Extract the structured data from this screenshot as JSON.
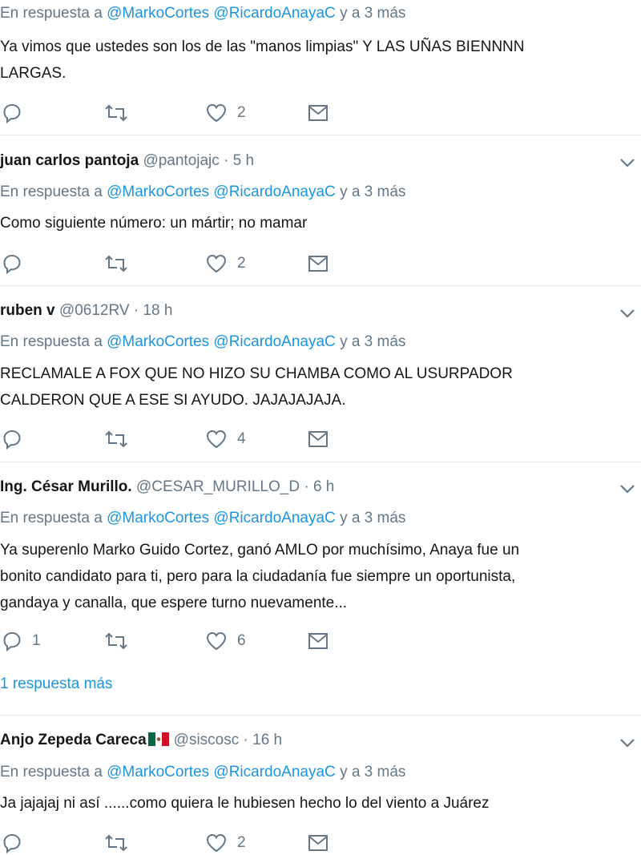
{
  "tweets": [
    {
      "reply_prefix": "En respuesta a",
      "reply_to_1": "@MarkoCortes",
      "reply_to_2": "@RicardoAnayaC",
      "reply_suffix": "y a 3 más",
      "text_1": "Ya vimos que ustedes son los de las \"manos limpias\" Y LAS UÑAS BIENNNN",
      "text_2": "LARGAS.",
      "reply_count": "",
      "like_count": "2"
    },
    {
      "name": "juan carlos pantoja",
      "handle": "@pantojajc",
      "dot": "·",
      "time": "5 h",
      "reply_prefix": "En respuesta a",
      "reply_to_1": "@MarkoCortes",
      "reply_to_2": "@RicardoAnayaC",
      "reply_suffix": "y a 3 más",
      "text_1": "Como siguiente número: un mártir; no mamar",
      "reply_count": "",
      "like_count": "2"
    },
    {
      "name": "ruben v",
      "handle": "@0612RV",
      "dot": "·",
      "time": "18 h",
      "reply_prefix": "En respuesta a",
      "reply_to_1": "@MarkoCortes",
      "reply_to_2": "@RicardoAnayaC",
      "reply_suffix": "y a 3 más",
      "text_1": "RECLAMALE A FOX QUE NO HIZO SU CHAMBA COMO AL USURPADOR",
      "text_2": "CALDERON QUE A ESE SI AYUDO. JAJAJAJAJA.",
      "reply_count": "",
      "like_count": "4"
    },
    {
      "name": "Ing. César Murillo.",
      "handle": "@CESAR_MURILLO_D",
      "dot": "·",
      "time": "6 h",
      "reply_prefix": "En respuesta a",
      "reply_to_1": "@MarkoCortes",
      "reply_to_2": "@RicardoAnayaC",
      "reply_suffix": "y a 3 más",
      "text_1": "Ya superenlo Marko Guido Cortez, ganó AMLO por muchísimo, Anaya fue un",
      "text_2": "bonito candidato para ti, pero para la ciudadanía fue siempre un oportunista,",
      "text_3": "gandaya y canalla, que espere turno nuevamente...",
      "reply_count": "1",
      "like_count": "6"
    },
    {
      "name": "Anjo Zepeda Careca",
      "handle": "@siscosc",
      "dot": "·",
      "time": "16 h",
      "reply_prefix": "En respuesta a",
      "reply_to_1": "@MarkoCortes",
      "reply_to_2": "@RicardoAnayaC",
      "reply_suffix": "y a 3 más",
      "text_1": "Ja jajajaj ni así ......como quiera le hubiesen hecho lo del viento a Juárez",
      "reply_count": "",
      "like_count": "2"
    }
  ],
  "more_replies": "1 respuesta más",
  "icons": {
    "reply": "reply-icon",
    "retweet": "retweet-icon",
    "like": "heart-icon",
    "dm": "envelope-icon",
    "caret": "chevron-down-icon",
    "flag": "mexico-flag-icon"
  },
  "colors": {
    "link": "#1b95e0",
    "muted": "#657786",
    "text": "#14171a",
    "divider": "#e6ecf0"
  }
}
